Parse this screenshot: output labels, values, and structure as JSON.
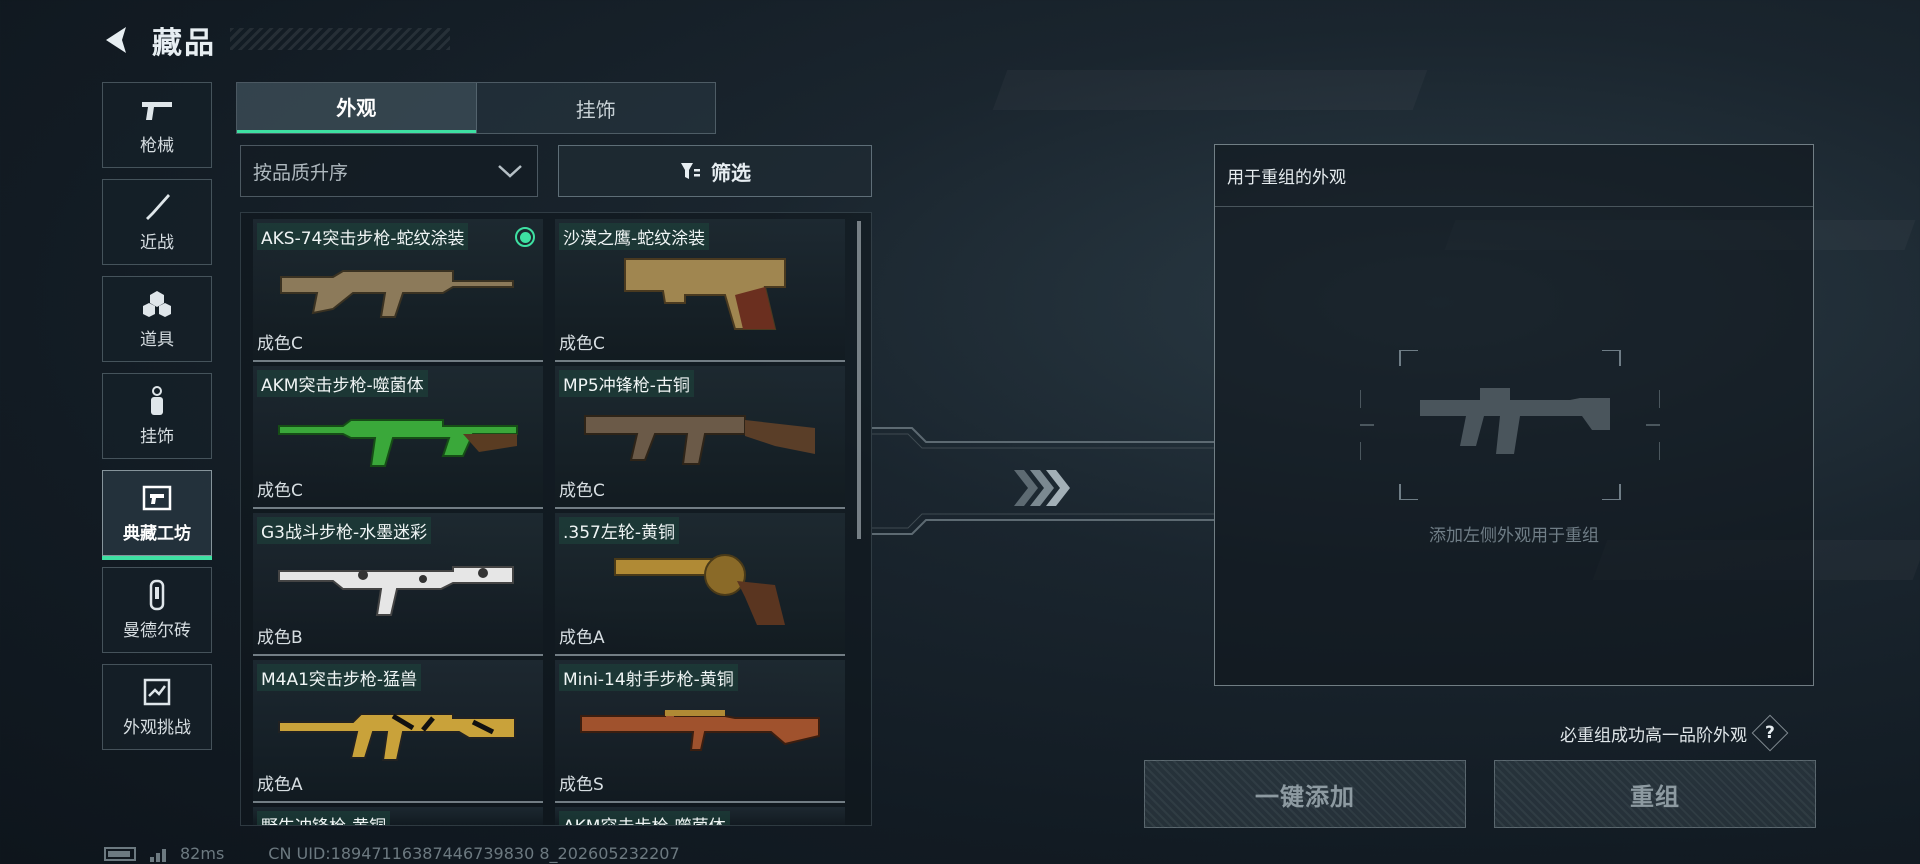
{
  "header": {
    "title": "藏品"
  },
  "sidebar": {
    "items": [
      {
        "label": "枪械",
        "icon": "pistol-icon"
      },
      {
        "label": "近战",
        "icon": "knife-icon"
      },
      {
        "label": "道具",
        "icon": "grenade-cluster-icon"
      },
      {
        "label": "挂饰",
        "icon": "keychain-icon"
      },
      {
        "label": "典藏工坊",
        "icon": "workshop-icon",
        "active": true
      },
      {
        "label": "曼德尔砖",
        "icon": "brick-icon"
      },
      {
        "label": "外观挑战",
        "icon": "challenge-icon"
      }
    ]
  },
  "tabs": [
    {
      "label": "外观",
      "active": true
    },
    {
      "label": "挂饰",
      "active": false
    }
  ],
  "sort": {
    "label": "按品质升序"
  },
  "filter": {
    "label": "筛选"
  },
  "items": [
    {
      "name": "AKS-74突击步枪-蛇纹涂装",
      "grade": "成色C",
      "selected": true,
      "gun_color": "#8c7a5a"
    },
    {
      "name": "沙漠之鹰-蛇纹涂装",
      "grade": "成色C",
      "selected": false,
      "gun_color": "#a08650"
    },
    {
      "name": "AKM突击步枪-噬菌体",
      "grade": "成色C",
      "selected": false,
      "gun_color": "#3aa83a"
    },
    {
      "name": "MP5冲锋枪-古铜",
      "grade": "成色C",
      "selected": false,
      "gun_color": "#6b5a48"
    },
    {
      "name": "G3战斗步枪-水墨迷彩",
      "grade": "成色B",
      "selected": false,
      "gun_color": "#e6e6e6"
    },
    {
      "name": ".357左轮-黄铜",
      "grade": "成色A",
      "selected": false,
      "gun_color": "#b08a35"
    },
    {
      "name": "M4A1突击步枪-猛兽",
      "grade": "成色A",
      "selected": false,
      "gun_color": "#c9a23a"
    },
    {
      "name": "Mini-14射手步枪-黄铜",
      "grade": "成色S",
      "selected": false,
      "gun_color": "#a0522d"
    }
  ],
  "partial_items": [
    {
      "name": "野牛冲锋枪-黄铜"
    },
    {
      "name": "AKM突击步枪-噬菌体"
    }
  ],
  "recombine": {
    "panel_title": "用于重组的外观",
    "slot_hint": "添加左侧外观用于重组",
    "info_text": "必重组成功高一品阶外观",
    "help_label": "?",
    "add_all_label": "一键添加",
    "recombine_label": "重组"
  },
  "status": {
    "latency": "82ms",
    "uid": "CN UID:18947116387446739830 8_202605232207"
  }
}
